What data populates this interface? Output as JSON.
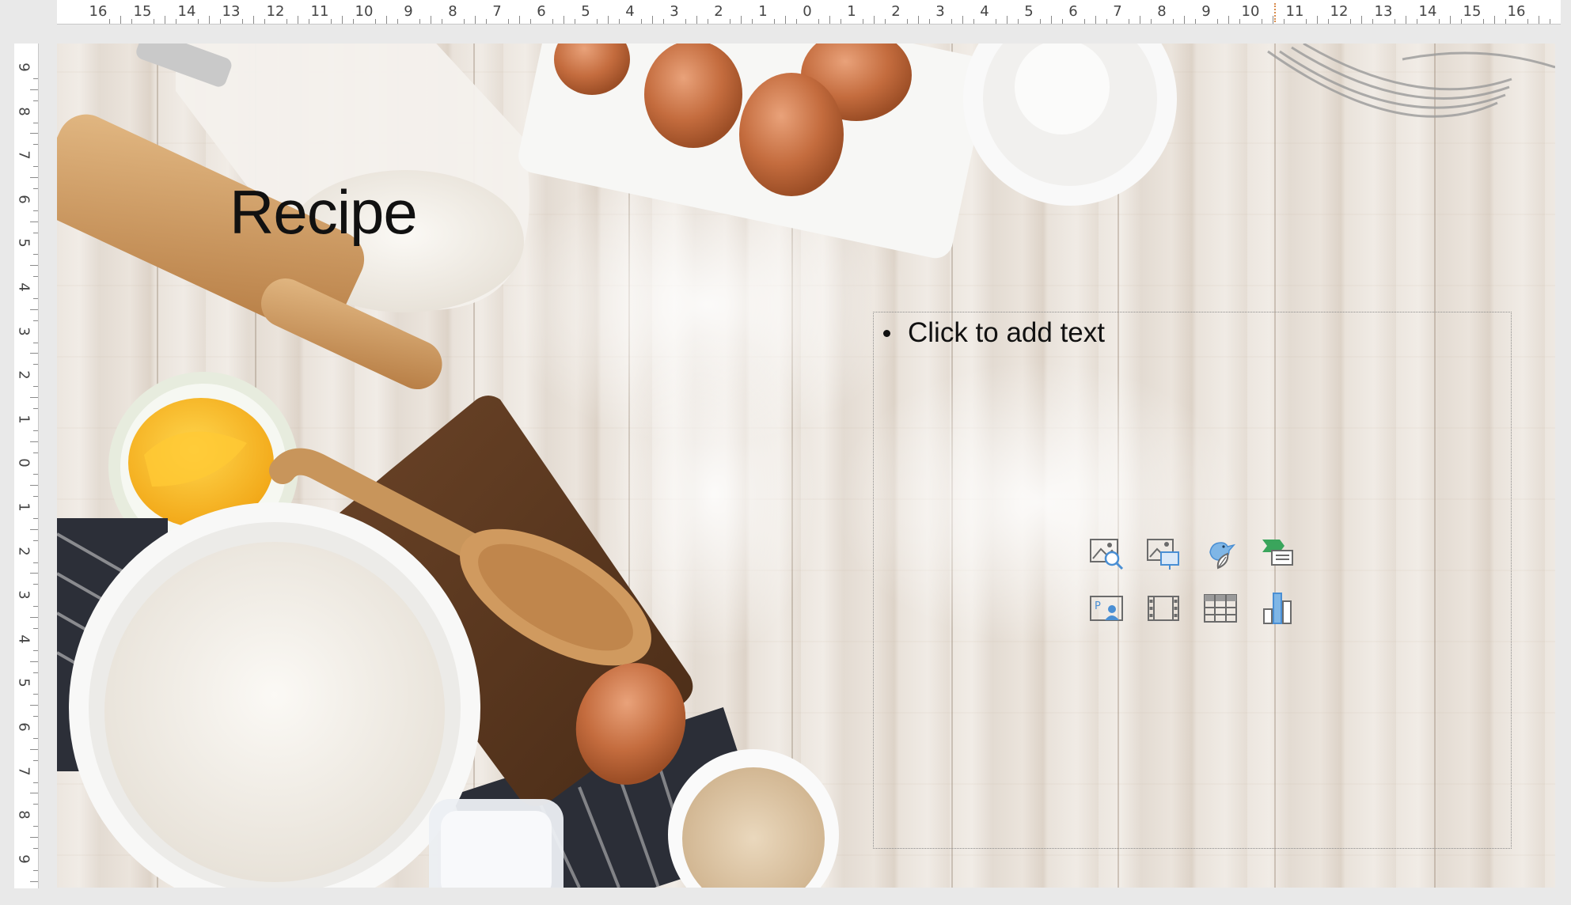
{
  "ruler": {
    "horizontal_labels": [
      "16",
      "15",
      "14",
      "13",
      "12",
      "11",
      "10",
      "9",
      "8",
      "7",
      "6",
      "5",
      "4",
      "3",
      "2",
      "1",
      "0",
      "1",
      "2",
      "3",
      "4",
      "5",
      "6",
      "7",
      "8",
      "9",
      "10",
      "11",
      "12",
      "13",
      "14",
      "15",
      "16"
    ],
    "vertical_labels": [
      "9",
      "8",
      "7",
      "6",
      "5",
      "4",
      "3",
      "2",
      "1",
      "0",
      "1",
      "2",
      "3",
      "4",
      "5",
      "6",
      "7",
      "8",
      "9"
    ]
  },
  "slide": {
    "title": "Recipe",
    "placeholder_text": "Click to add text"
  },
  "insert_icons": [
    {
      "name": "insert-pictures-icon"
    },
    {
      "name": "insert-stock-images-icon"
    },
    {
      "name": "insert-icons-icon"
    },
    {
      "name": "insert-smartart-icon"
    },
    {
      "name": "insert-cameo-icon"
    },
    {
      "name": "insert-video-icon"
    },
    {
      "name": "insert-table-icon"
    },
    {
      "name": "insert-chart-icon"
    }
  ],
  "colors": {
    "accent_blue": "#4a8fd4",
    "accent_green": "#3aa55c",
    "icon_gray": "#6b6b6b"
  }
}
